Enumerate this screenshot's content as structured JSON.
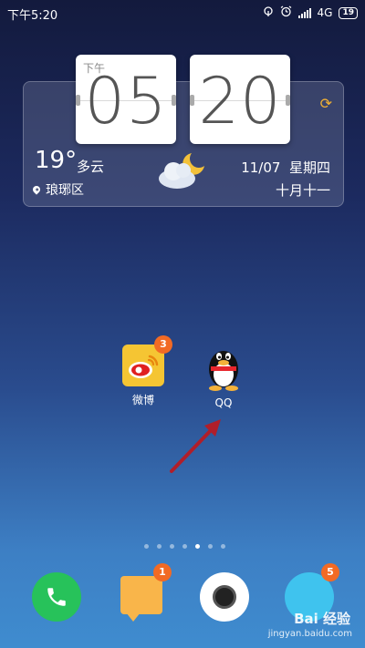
{
  "status_bar": {
    "time": "下午5:20",
    "network": "4G",
    "battery": "19"
  },
  "clock": {
    "ampm": "下午",
    "hour": "05",
    "minute": "20"
  },
  "weather": {
    "temperature": "19°",
    "description": "多云",
    "location": "琅琊区",
    "date": "11/07",
    "weekday": "星期四",
    "lunar_date": "十月十一"
  },
  "apps": [
    {
      "label": "微博",
      "badge": "3"
    },
    {
      "label": "QQ"
    }
  ],
  "page_indicator": {
    "count": 7,
    "active_index": 4
  },
  "dock": [
    {
      "name": "phone"
    },
    {
      "name": "messages",
      "badge": "1"
    },
    {
      "name": "camera"
    },
    {
      "name": "browser",
      "badge": "5"
    }
  ],
  "watermark": {
    "brand": "Bai 经验",
    "url": "jingyan.baidu.com"
  },
  "colors": {
    "badge": "#f26a24",
    "phone": "#27c25a",
    "weibo": "#f5c533",
    "arrow": "#b01e2a"
  }
}
